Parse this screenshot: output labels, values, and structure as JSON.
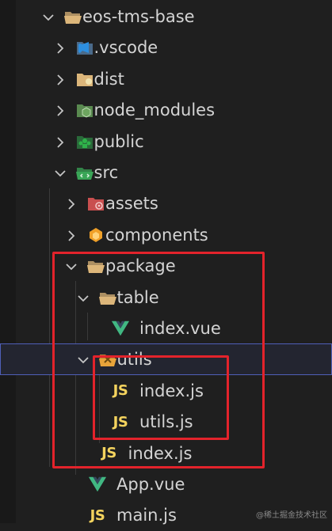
{
  "tree": [
    {
      "label": "eos-tms-base",
      "kind": "folder-open",
      "icon": "folder-open-icon",
      "depth": 0,
      "chevron": "down"
    },
    {
      "label": ".vscode",
      "kind": "folder",
      "icon": "vscode-folder-icon",
      "depth": 1,
      "chevron": "right"
    },
    {
      "label": "dist",
      "kind": "folder",
      "icon": "dist-folder-icon",
      "depth": 1,
      "chevron": "right"
    },
    {
      "label": "node_modules",
      "kind": "folder",
      "icon": "node-modules-folder-icon",
      "depth": 1,
      "chevron": "right"
    },
    {
      "label": "public",
      "kind": "folder",
      "icon": "public-folder-icon",
      "depth": 1,
      "chevron": "right"
    },
    {
      "label": "src",
      "kind": "folder-open",
      "icon": "src-folder-icon",
      "depth": 1,
      "chevron": "down"
    },
    {
      "label": "assets",
      "kind": "folder",
      "icon": "assets-folder-icon",
      "depth": 2,
      "chevron": "right"
    },
    {
      "label": "components",
      "kind": "folder",
      "icon": "components-folder-icon",
      "depth": 2,
      "chevron": "right"
    },
    {
      "label": "package",
      "kind": "folder-open",
      "icon": "folder-open-icon",
      "depth": 2,
      "chevron": "down"
    },
    {
      "label": "table",
      "kind": "folder-open",
      "icon": "folder-open-icon",
      "depth": 3,
      "chevron": "down"
    },
    {
      "label": "index.vue",
      "kind": "vue",
      "icon": "vue-file-icon",
      "depth": 4,
      "chevron": ""
    },
    {
      "label": "utils",
      "kind": "folder-open",
      "icon": "utils-folder-icon",
      "depth": 3,
      "chevron": "down",
      "selected": true
    },
    {
      "label": "index.js",
      "kind": "js",
      "icon": "js-file-icon",
      "depth": 4,
      "chevron": ""
    },
    {
      "label": "utils.js",
      "kind": "js",
      "icon": "js-file-icon",
      "depth": 4,
      "chevron": ""
    },
    {
      "label": "index.js",
      "kind": "js",
      "icon": "js-file-icon",
      "depth": 3,
      "chevron": ""
    },
    {
      "label": "App.vue",
      "kind": "vue",
      "icon": "vue-file-icon",
      "depth": 2,
      "chevron": ""
    },
    {
      "label": "main.js",
      "kind": "js",
      "icon": "js-file-icon",
      "depth": 2,
      "chevron": ""
    }
  ],
  "js_badge": "JS",
  "watermark": "@稀土掘金技术社区",
  "colors": {
    "folder": "#dcb67a",
    "vscode": "#2d8fe0",
    "node": "#6da55f",
    "public": "#2fb34a",
    "src": "#3aa657",
    "assets": "#c94f4f",
    "components": "#f0a028",
    "utils": "#e8a43a",
    "vue": "#41b883",
    "js": "#f4d35e",
    "highlight": "#e3232b"
  }
}
